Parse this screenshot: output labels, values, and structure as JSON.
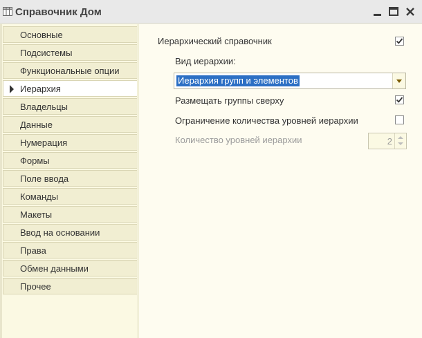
{
  "window": {
    "title": "Справочник Дом",
    "icon": "table-icon"
  },
  "nav": {
    "items": [
      {
        "label": "Основные",
        "active": false
      },
      {
        "label": "Подсистемы",
        "active": false
      },
      {
        "label": "Функциональные опции",
        "active": false
      },
      {
        "label": "Иерархия",
        "active": true
      },
      {
        "label": "Владельцы",
        "active": false
      },
      {
        "label": "Данные",
        "active": false
      },
      {
        "label": "Нумерация",
        "active": false
      },
      {
        "label": "Формы",
        "active": false
      },
      {
        "label": "Поле ввода",
        "active": false
      },
      {
        "label": "Команды",
        "active": false
      },
      {
        "label": "Макеты",
        "active": false
      },
      {
        "label": "Ввод на основании",
        "active": false
      },
      {
        "label": "Права",
        "active": false
      },
      {
        "label": "Обмен данными",
        "active": false
      },
      {
        "label": "Прочее",
        "active": false
      }
    ]
  },
  "hierarchy": {
    "hierarchical_label": "Иерархический справочник",
    "hierarchical_checked": true,
    "type_label": "Вид иерархии:",
    "type_value": "Иерархия групп и элементов",
    "groups_on_top_label": "Размещать группы сверху",
    "groups_on_top_checked": true,
    "limit_levels_label": "Ограничение количества уровней иерархии",
    "limit_levels_checked": false,
    "levels_count_label": "Количество уровней иерархии",
    "levels_count_value": "2"
  },
  "colors": {
    "background": "#fbf9e3",
    "selection": "#2c6fc4"
  }
}
